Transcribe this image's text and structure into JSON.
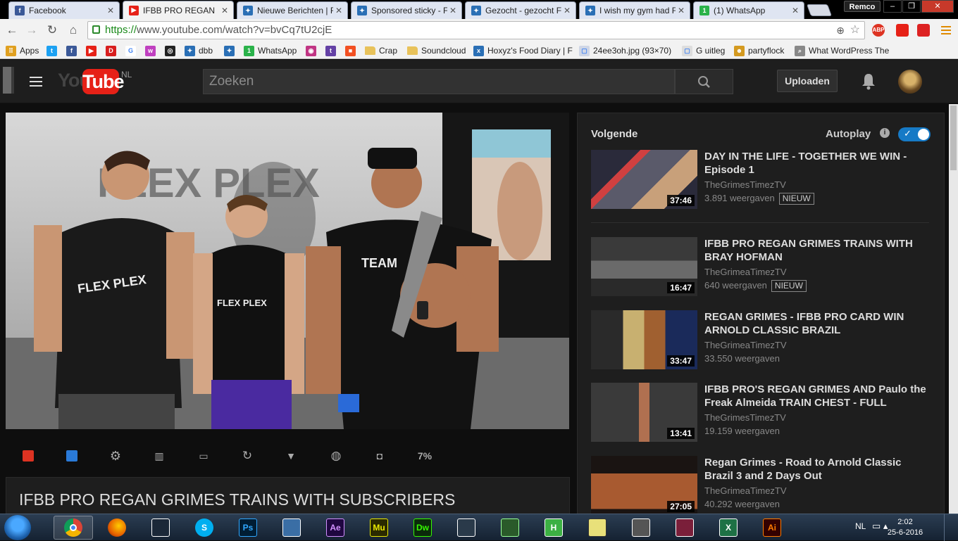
{
  "browser": {
    "tabs": [
      {
        "label": "Facebook",
        "favicon_color": "#3b5998",
        "favicon": "f",
        "active": false
      },
      {
        "label": "IFBB PRO REGAN",
        "favicon_color": "#e62117",
        "favicon": "▶",
        "active": true
      },
      {
        "label": "Nieuwe Berichten | F",
        "favicon_color": "#2a6fb5",
        "favicon": "✦",
        "active": false
      },
      {
        "label": "Sponsored sticky - F",
        "favicon_color": "#2a6fb5",
        "favicon": "✦",
        "active": false
      },
      {
        "label": "Gezocht - gezocht F",
        "favicon_color": "#2a6fb5",
        "favicon": "✦",
        "active": false
      },
      {
        "label": "I wish my gym had F",
        "favicon_color": "#2a6fb5",
        "favicon": "✦",
        "active": false
      },
      {
        "label": "(1) WhatsApp",
        "favicon_color": "#2ab24a",
        "favicon": "1",
        "active": false
      }
    ],
    "profile_name": "Remco",
    "url_scheme": "https://",
    "url_rest": "www.youtube.com/watch?v=bvCq7tU2cjE",
    "bookmarks": [
      {
        "label": "Apps",
        "icon_color": "#e0a020",
        "icon": "⠿"
      },
      {
        "label": "",
        "icon_color": "#1da1f2",
        "icon": "t"
      },
      {
        "label": "",
        "icon_color": "#3b5998",
        "icon": "f"
      },
      {
        "label": "",
        "icon_color": "#e62117",
        "icon": "▶"
      },
      {
        "label": "",
        "icon_color": "#d81e1e",
        "icon": "D"
      },
      {
        "label": "",
        "icon_color": "#ffffff",
        "icon": "G"
      },
      {
        "label": "",
        "icon_color": "#c040c0",
        "icon": "w"
      },
      {
        "label": "",
        "icon_color": "#222222",
        "icon": "◎"
      },
      {
        "label": "dbb",
        "icon_color": "#2a6fb5",
        "icon": "✦"
      },
      {
        "label": "",
        "icon_color": "#2a6fb5",
        "icon": "✦"
      },
      {
        "label": "WhatsApp",
        "icon_color": "#2ab24a",
        "icon": "1"
      },
      {
        "label": "",
        "icon_color": "#c13584",
        "icon": "◉"
      },
      {
        "label": "",
        "icon_color": "#6441a5",
        "icon": "t"
      },
      {
        "label": "",
        "icon_color": "#f25022",
        "icon": "■"
      },
      {
        "label": "Crap",
        "icon_color": "#e8c25a",
        "icon": ""
      },
      {
        "label": "Soundcloud",
        "icon_color": "#e8c25a",
        "icon": ""
      },
      {
        "label": "Hoxyz's Food Diary | F",
        "icon_color": "#2a6fb5",
        "icon": "x"
      },
      {
        "label": "24ee3oh.jpg (93×70)",
        "icon_color": "#cfd6e6",
        "icon": "▢"
      },
      {
        "label": "G uitleg",
        "icon_color": "#dddddd",
        "icon": "▢"
      },
      {
        "label": "partyflock",
        "icon_color": "#d49a20",
        "icon": "☻"
      },
      {
        "label": "What WordPress The",
        "icon_color": "#888888",
        "icon": "⌕"
      }
    ]
  },
  "youtube": {
    "locale": "NL",
    "search_placeholder": "Zoeken",
    "upload_label": "Uploaden",
    "video_title": "IFBB PRO REGAN GRIMES TRAINS WITH SUBSCRIBERS",
    "player_controls": [
      "record",
      "expand",
      "settings",
      "film",
      "caption",
      "loop",
      "filter",
      "palette",
      "screenshot"
    ],
    "zoom_label": "7%",
    "sidebar": {
      "next_label": "Volgende",
      "autoplay_label": "Autoplay",
      "autoplay_on": true,
      "videos": [
        {
          "title": "DAY IN THE LIFE - TOGETHER WE WIN - Episode 1",
          "channel": "TheGrimesTimezTV",
          "views": "3.891 weergaven",
          "badge": "NIEUW",
          "duration": "37:46"
        },
        {
          "title": "IFBB PRO REGAN GRIMES TRAINS WITH BRAY HOFMAN",
          "channel": "TheGrimeaTimezTV",
          "views": "640 weergaven",
          "badge": "NIEUW",
          "duration": "16:47"
        },
        {
          "title": "REGAN GRIMES - IFBB PRO CARD WIN ARNOLD CLASSIC BRAZIL",
          "channel": "TheGrimeaTimezTV",
          "views": "33.550 weergaven",
          "badge": "",
          "duration": "33:47"
        },
        {
          "title": "IFBB PRO'S REGAN GRIMES AND Paulo the Freak Almeida TRAIN CHEST - FULL",
          "channel": "TheGrimesTimezTV",
          "views": "19.159 weergaven",
          "badge": "",
          "duration": "13:41"
        },
        {
          "title": "Regan Grimes - Road to Arnold Classic Brazil 3 and 2 Days Out",
          "channel": "TheGrimeaTimezTV",
          "views": "40.292 weergaven",
          "badge": "",
          "duration": "27:05"
        }
      ]
    }
  },
  "taskbar": {
    "language": "NL",
    "time": "2:02",
    "date": "25-6-2016",
    "apps": [
      {
        "name": "chrome",
        "label": "",
        "bg": "#ffffff",
        "fg": "#db4437"
      },
      {
        "name": "firefox",
        "label": "",
        "bg": "#e66000",
        "fg": "#fff"
      },
      {
        "name": "steam",
        "label": "",
        "bg": "#1b2838",
        "fg": "#fff"
      },
      {
        "name": "skype",
        "label": "S",
        "bg": "#00aff0",
        "fg": "#fff"
      },
      {
        "name": "photoshop",
        "label": "Ps",
        "bg": "#001d34",
        "fg": "#31a8ff"
      },
      {
        "name": "keyboard",
        "label": "",
        "bg": "#3a6ea5",
        "fg": "#fff"
      },
      {
        "name": "after-effects",
        "label": "Ae",
        "bg": "#1f0740",
        "fg": "#d291ff"
      },
      {
        "name": "muse",
        "label": "Mu",
        "bg": "#2a2a00",
        "fg": "#e9e900"
      },
      {
        "name": "dreamweaver",
        "label": "Dw",
        "bg": "#0b2a0b",
        "fg": "#35fa00"
      },
      {
        "name": "film",
        "label": "",
        "bg": "#2a3a4a",
        "fg": "#fff"
      },
      {
        "name": "camtasia",
        "label": "",
        "bg": "#2a5a2a",
        "fg": "#9f9"
      },
      {
        "name": "h-app",
        "label": "H",
        "bg": "#3cb043",
        "fg": "#fff"
      },
      {
        "name": "notes",
        "label": "",
        "bg": "#e8e07a",
        "fg": "#333"
      },
      {
        "name": "game",
        "label": "",
        "bg": "#555",
        "fg": "#fff"
      },
      {
        "name": "spider",
        "label": "",
        "bg": "#7a1f3a",
        "fg": "#fff"
      },
      {
        "name": "excel",
        "label": "X",
        "bg": "#1e7145",
        "fg": "#fff"
      },
      {
        "name": "illustrator",
        "label": "Ai",
        "bg": "#330000",
        "fg": "#ff7c00"
      }
    ]
  }
}
